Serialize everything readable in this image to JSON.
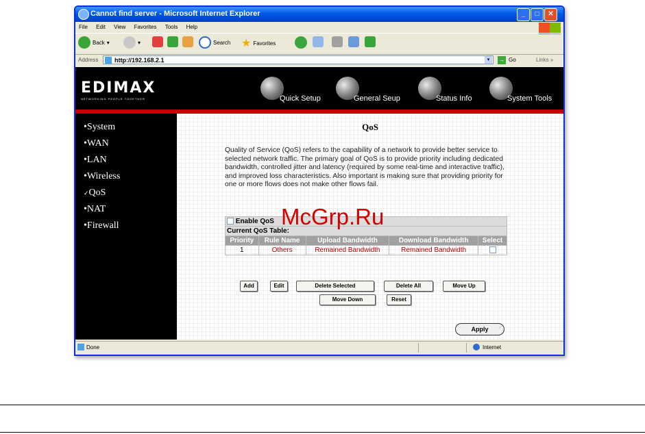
{
  "browser": {
    "title": "Cannot find server - Microsoft Internet Explorer",
    "menu": [
      "File",
      "Edit",
      "View",
      "Favorites",
      "Tools",
      "Help"
    ],
    "toolbar": {
      "back": "Back",
      "search": "Search",
      "favorites": "Favorites"
    },
    "address_label": "Address",
    "address": "http://192.168.2.1",
    "go": "Go",
    "links": "Links »",
    "status_left": "Done",
    "status_right": "Internet"
  },
  "router": {
    "logo": "EDIMAX",
    "tagline": "NETWORKING PEOPLE TOGETHER",
    "nav": [
      "Quick Setup",
      "General Seup",
      "Status Info",
      "System Tools"
    ],
    "sidebar": [
      "System",
      "WAN",
      "LAN",
      "Wireless",
      "QoS",
      "NAT",
      "Firewall"
    ],
    "sidebar_bullets": [
      "•",
      "•",
      "•",
      "•",
      "✓",
      "•",
      "•"
    ],
    "page_title": "QoS",
    "description": "Quality of Service (QoS) refers to the capability of a network to provide better service to selected network traffic. The primary goal of QoS is to provide priority including dedicated bandwidth, controlled jitter and latency (required by some real-time and interactive traffic), and improved loss characteristics. Also important is making sure that providing priority for one or more flows does not make other flows fail.",
    "enable_label": "Enable QoS",
    "table_title": "Current QoS Table:",
    "columns": [
      "Priority",
      "Rule Name",
      "Upload Bandwidth",
      "Download Bandwidth",
      "Select"
    ],
    "rows": [
      {
        "priority": "1",
        "rule_name": "Others",
        "upload": "Remained Bandwidth",
        "download": "Remained Bandwidth"
      }
    ],
    "buttons": {
      "add": "Add",
      "edit": "Edit",
      "delete_selected": "Delete Selected",
      "delete_all": "Delete All",
      "move_up": "Move Up",
      "move_down": "Move Down",
      "reset": "Reset",
      "apply": "Apply"
    }
  },
  "watermark": "McGrp.Ru",
  "colors": {
    "accent_red": "#c00000",
    "title_blue": "#0058e6"
  }
}
